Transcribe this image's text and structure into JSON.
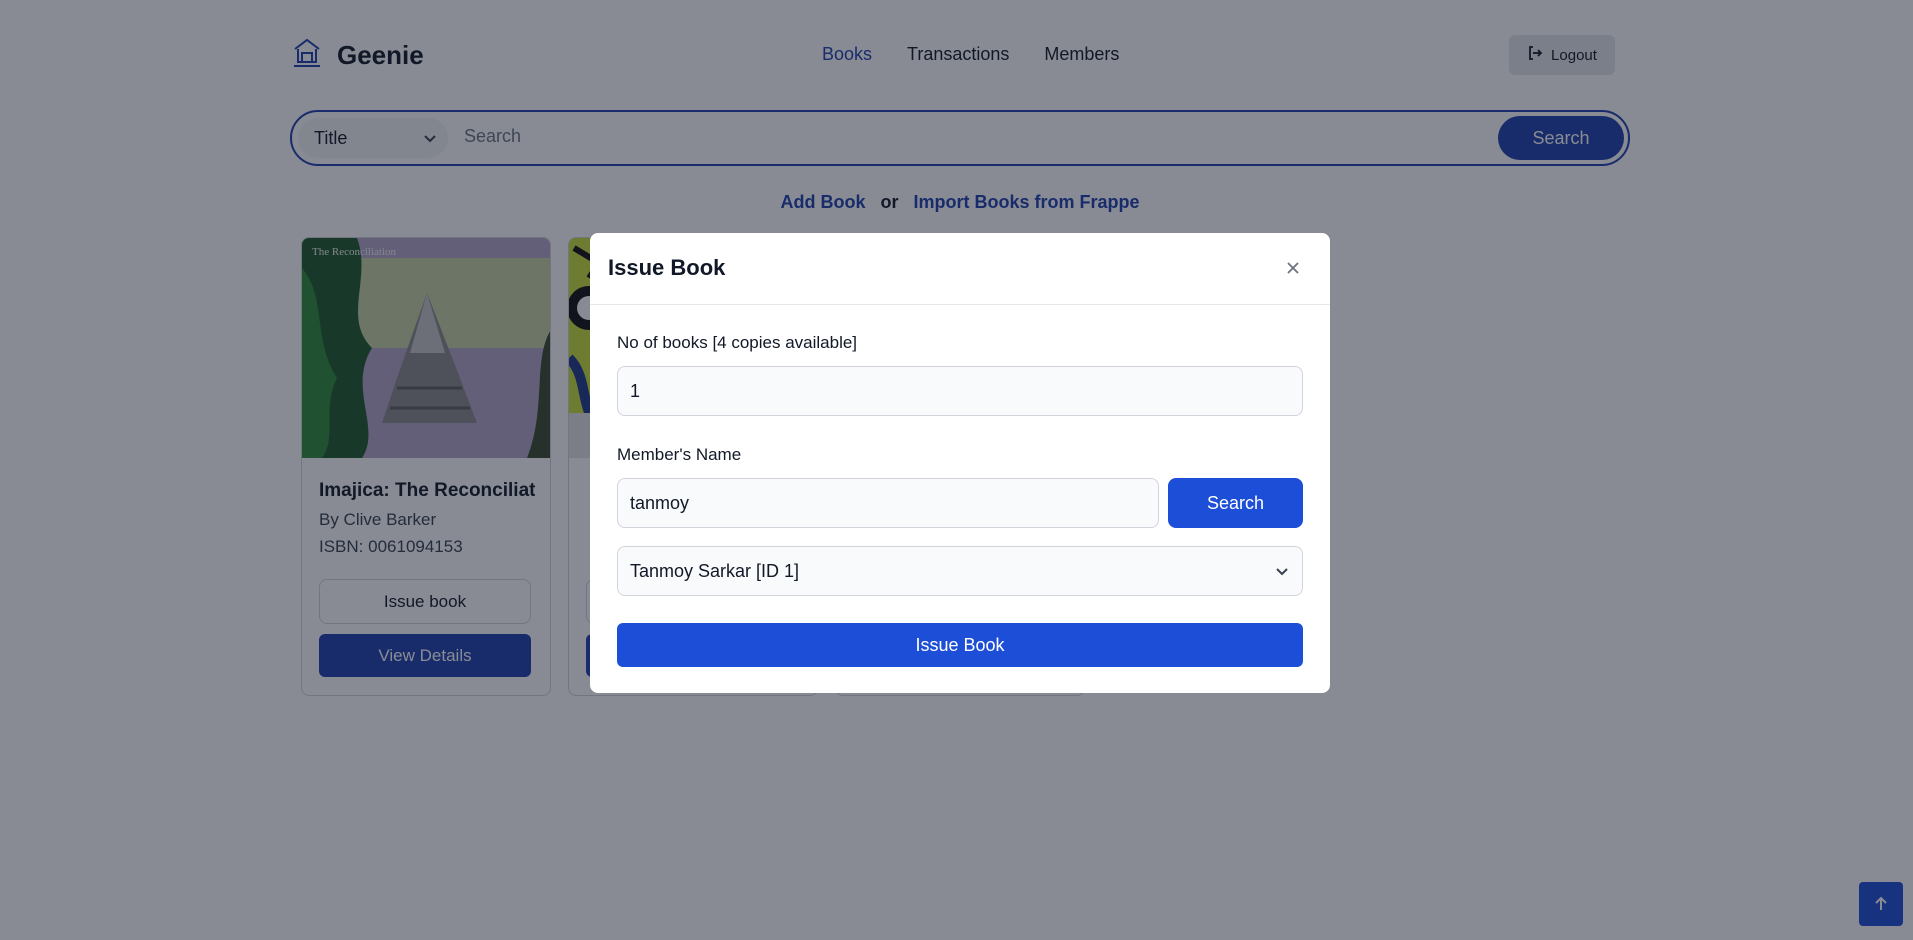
{
  "app": {
    "brand": "Geenie"
  },
  "nav": {
    "books": "Books",
    "transactions": "Transactions",
    "members": "Members"
  },
  "header": {
    "logout": "Logout"
  },
  "search": {
    "filter": "Title",
    "placeholder": "Search",
    "button": "Search"
  },
  "actions": {
    "add": "Add Book",
    "or": "or",
    "import": "Import Books from Frappe"
  },
  "books": [
    {
      "title": "Imajica: The Reconciliation",
      "author": "By Clive Barker",
      "isbn": "ISBN: 0061094153",
      "cover_text": "The Reconciliation",
      "issue": "Issue book",
      "details": "View Details"
    },
    {
      "title": "",
      "author": "",
      "isbn": "",
      "issue": "",
      "details": ""
    }
  ],
  "modal": {
    "title": "Issue Book",
    "qty_label": "No of books [4 copies available]",
    "qty_value": "1",
    "member_label": "Member's Name",
    "member_value": "tanmoy",
    "search_button": "Search",
    "member_selected": "Tanmoy Sarkar [ID 1]",
    "issue_button": "Issue Book"
  },
  "colors": {
    "primary": "#1e40af",
    "accent": "#1d4ed8",
    "overlay": "rgba(17,24,39,0.5)"
  },
  "icons": {
    "brand": "library-icon",
    "logout": "logout-icon",
    "close": "close-icon",
    "scroll_top": "arrow-up-icon"
  }
}
